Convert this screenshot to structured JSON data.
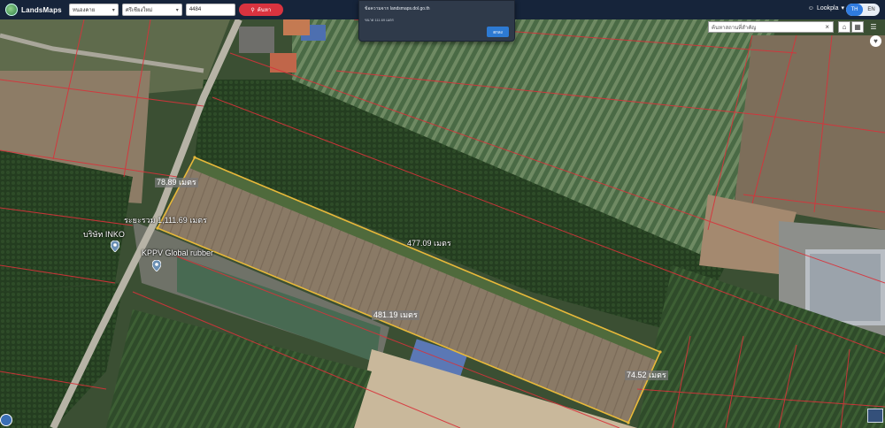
{
  "header": {
    "app_name": "LandsMaps",
    "province_select": "หนองคาย",
    "amphoe_select": "ศรีเชียงใหม่",
    "parcel_input": "4484",
    "search_label": "ค้นหา",
    "user_name": "Lookpla",
    "lang_th": "TH",
    "lang_en": "EN"
  },
  "alert": {
    "title": "ข้อความจาก landsmaps.dol.go.th",
    "message": "ขนาด 111.69 เมตร",
    "ok_label": "ตกลง"
  },
  "place_search": {
    "placeholder": "ค้นหาสถานที่สำคัญ"
  },
  "icons": {
    "search": "search-icon",
    "user": "user-icon",
    "clear": "close-icon",
    "building": "building-icon",
    "grid": "grid-icon",
    "layers": "layers-icon",
    "favorite": "heart-icon",
    "poi": "map-pin-icon"
  },
  "measurements": {
    "side_left": "78.89 เมตร",
    "total": "ระยะรวม 1,111.69 เมตร",
    "side_top": "477.09 เมตร",
    "side_bottom": "481.19 เมตร",
    "side_right": "74.52 เมตร"
  },
  "pois": [
    {
      "label": "บริษัท INKO"
    },
    {
      "label": "KPPV Global rubber"
    }
  ],
  "colors": {
    "parcel_outline": "#e8b93a",
    "cadastral_lines": "#d8323a",
    "topbar": "#16243a",
    "search_button": "#d9333f"
  }
}
